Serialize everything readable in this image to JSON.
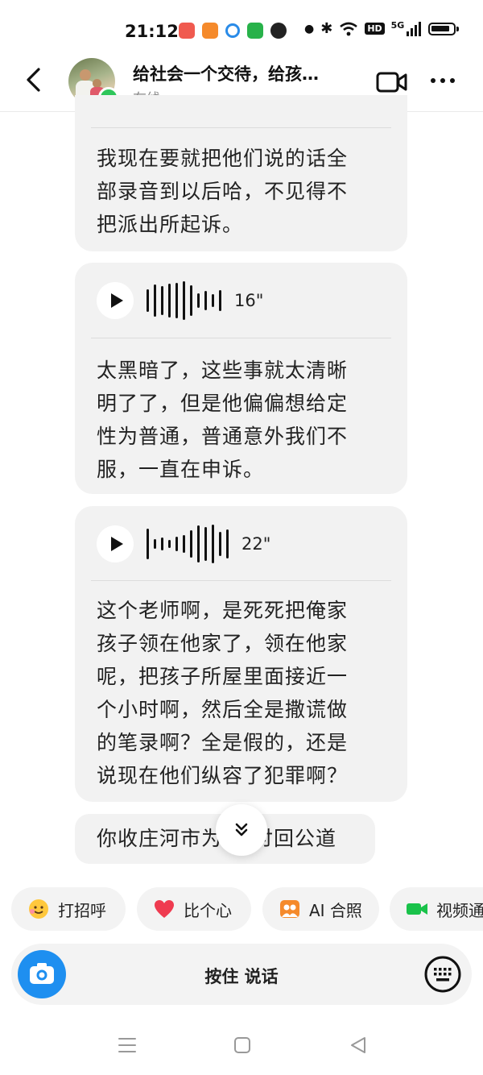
{
  "status": {
    "time": "21:12",
    "network": "5G",
    "hd": "HD"
  },
  "header": {
    "title": "给社会一个交待，给孩…",
    "status": "在线"
  },
  "messages": [
    {
      "type": "text",
      "text_lines": [
        "我现在要就把他们说的话全",
        "部录音到以后哈，不见得不",
        "把派出所起诉。"
      ]
    },
    {
      "type": "voice",
      "duration": "16\"",
      "text_lines": [
        "太黑暗了，这些事就太清晰",
        "明了了，但是他偏偏想给定",
        "性为普通，普通意外我们不",
        "服，一直在申诉。"
      ]
    },
    {
      "type": "voice",
      "duration": "22\"",
      "text_lines": [
        "这个老师啊，是死死把俺家",
        "孩子领在他家了，领在他家",
        "呢，把孩子所屋里面接近一",
        "个小时啊，然后全是撒谎做",
        "的笔录啊？全是假的，还是",
        "说现在他们纵容了犯罪啊？"
      ]
    },
    {
      "type": "text",
      "text_lines": [
        "你收庄河市为",
        "讨回公道"
      ]
    }
  ],
  "quick_actions": [
    {
      "label": "打招呼",
      "icon": "wave-emoji-icon"
    },
    {
      "label": "比个心",
      "icon": "heart-icon"
    },
    {
      "label": "AI 合照",
      "icon": "ai-photo-icon"
    },
    {
      "label": "视频通",
      "icon": "video-call-icon"
    }
  ],
  "input": {
    "hold_to_talk": "按住 说话"
  },
  "colors": {
    "online": "#2fc65b",
    "camera": "#1e8ff0",
    "bubble": "#f2f2f2",
    "heart": "#ef3b50",
    "orange": "#f58a2b",
    "green": "#19c24a"
  }
}
